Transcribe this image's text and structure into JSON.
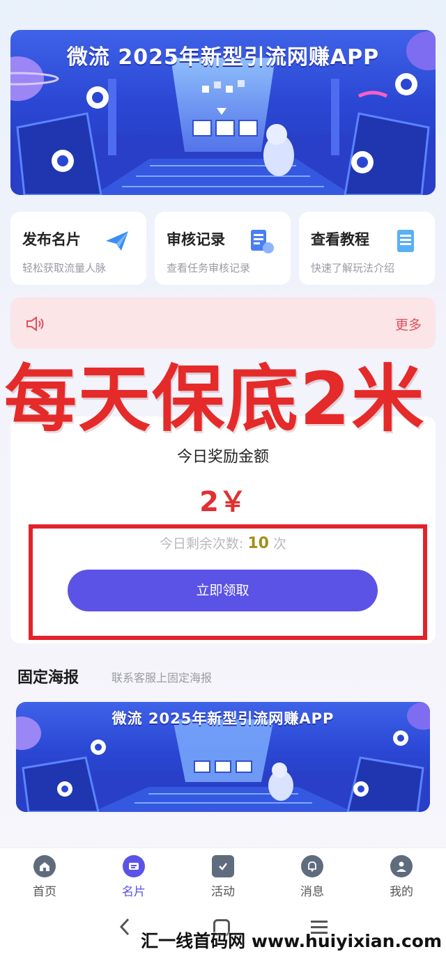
{
  "banner_top": {
    "title": "微流 2025年新型引流网赚APP"
  },
  "cards": [
    {
      "title": "发布名片",
      "subtitle": "轻松获取流量人脉",
      "icon": "paper-plane-icon"
    },
    {
      "title": "审核记录",
      "subtitle": "查看任务审核记录",
      "icon": "document-review-icon"
    },
    {
      "title": "查看教程",
      "subtitle": "快速了解玩法介绍",
      "icon": "tutorial-doc-icon"
    }
  ],
  "notice": {
    "more": "更多"
  },
  "overlay": {
    "text": "每天保底2米"
  },
  "reward": {
    "title": "今日奖励金额",
    "amount": "2￥",
    "remain_label": "今日剩余次数:",
    "remain_count": "10",
    "remain_unit": "次",
    "claim_button": "立即领取"
  },
  "poster": {
    "title": "固定海报",
    "subtitle": "联系客服上固定海报"
  },
  "banner_bottom": {
    "title": "微流 2025年新型引流网赚APP"
  },
  "nav": [
    {
      "label": "首页",
      "icon": "home-icon"
    },
    {
      "label": "名片",
      "icon": "card-icon",
      "active": true
    },
    {
      "label": "活动",
      "icon": "activity-icon"
    },
    {
      "label": "消息",
      "icon": "bell-icon"
    },
    {
      "label": "我的",
      "icon": "user-icon"
    }
  ],
  "watermark": "汇一线首码网 www.huiyixian.com",
  "colors": {
    "accent": "#5b53e6",
    "red": "#e52a2a",
    "notice_bg": "#fbe5e7"
  }
}
